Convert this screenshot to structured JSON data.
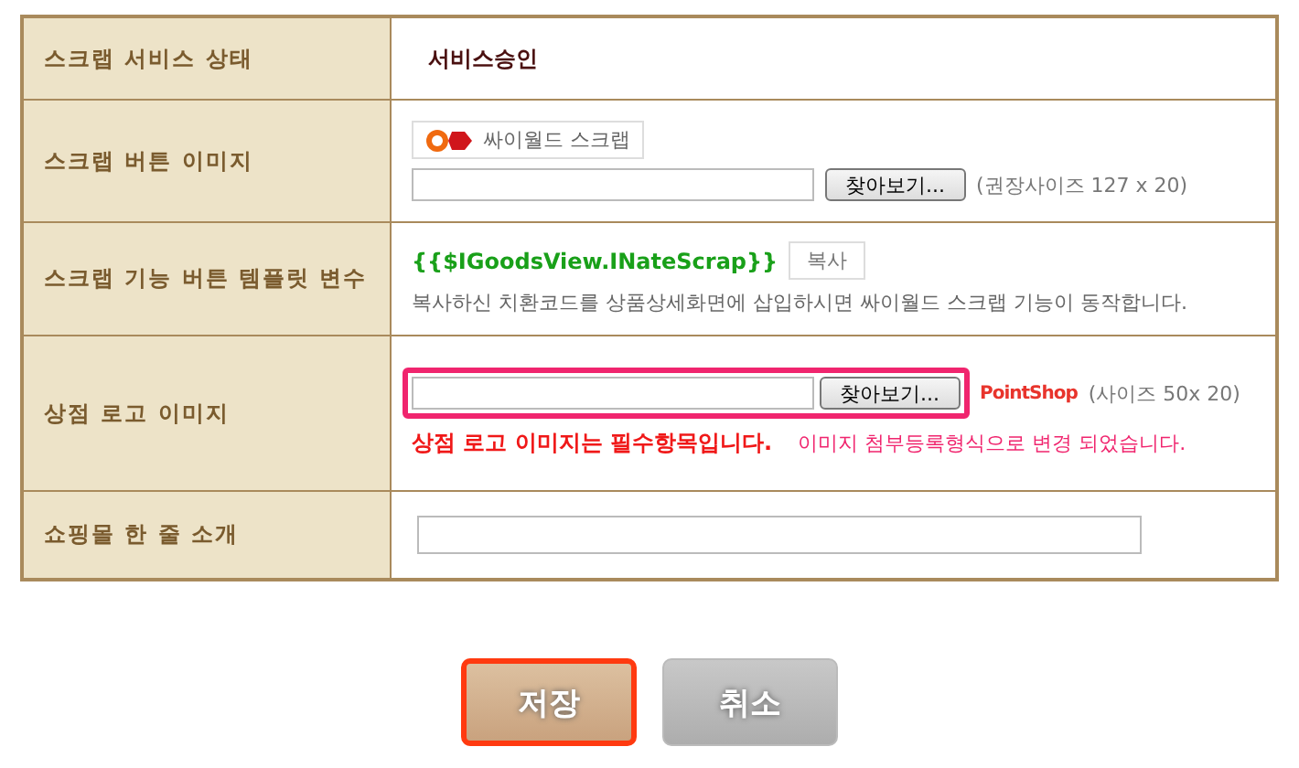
{
  "settings": [
    {
      "kind": "status",
      "label": "스크랩 서비스 상태",
      "value": "서비스승인"
    },
    {
      "kind": "button_image",
      "label": "스크랩 버튼 이미지",
      "preview_text": "싸이월드 스크랩",
      "browse_button": "찾아보기...",
      "note": "(권장사이즈 127 x 20)"
    },
    {
      "kind": "template",
      "label": "스크랩 기능 버튼 템플릿 변수",
      "code": "{{$IGoodsView.INateScrap}}",
      "copy_button": "복사",
      "description": "복사하신 치환코드를 상품상세화면에 삽입하시면 싸이월드 스크랩 기능이 동작합니다."
    },
    {
      "kind": "logo",
      "label": "상점 로고 이미지",
      "browse_button": "찾아보기...",
      "highlighted": true,
      "logo_text": "PointShop",
      "note": "(사이즈 50x 20)",
      "required_text": "상점 로고 이미지는 필수항목입니다.",
      "change_note": "이미지 첨부등록형식으로 변경 되었습니다."
    },
    {
      "kind": "intro",
      "label": "쇼핑몰 한 줄 소개"
    }
  ],
  "actions": [
    {
      "label": "저장",
      "kind": "save",
      "focused": true
    },
    {
      "label": "취소",
      "kind": "cancel",
      "focused": false
    }
  ]
}
